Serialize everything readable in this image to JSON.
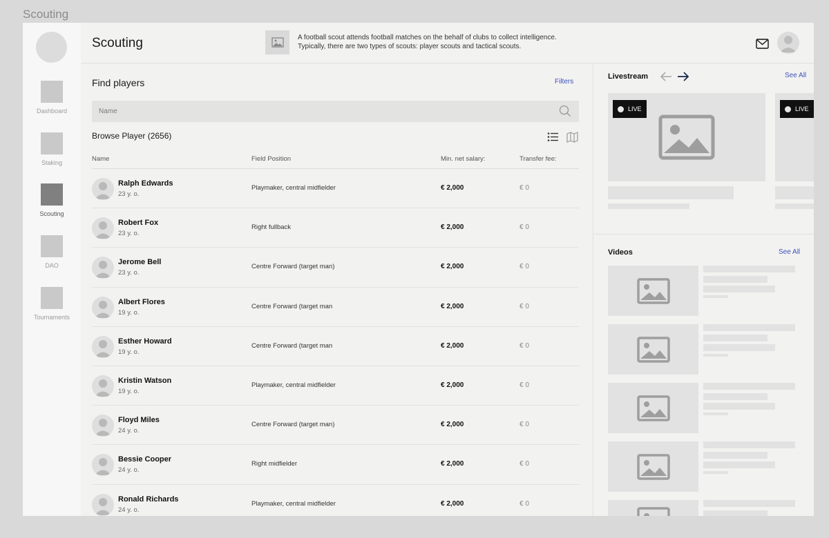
{
  "frame_label": "Scouting",
  "sidebar": {
    "items": [
      {
        "label": "Dashboard",
        "active": false
      },
      {
        "label": "Staking",
        "active": false
      },
      {
        "label": "Scouting",
        "active": true
      },
      {
        "label": "DAO",
        "active": false
      },
      {
        "label": "Tournaments",
        "active": false
      }
    ]
  },
  "header": {
    "title": "Scouting",
    "info_line1": "A football scout attends football matches on the behalf of clubs to collect intelligence.",
    "info_line2": "Typically, there are two types of scouts: player scouts and tactical scouts.",
    "mail_icon": "mail-icon"
  },
  "main": {
    "find_title": "Find players",
    "filters_label": "Filters",
    "search_placeholder": "Name",
    "browse_title": "Browse Player (2656)",
    "columns": {
      "name": "Name",
      "position": "Field Position",
      "salary": "Min. net salary:",
      "fee": "Transfer fee:"
    },
    "players": [
      {
        "name": "Ralph Edwards",
        "age": "23 y. o.",
        "position": "Playmaker, central midfielder",
        "salary": "€ 2,000",
        "fee": "€ 0"
      },
      {
        "name": "Robert Fox",
        "age": "23 y. o.",
        "position": "Right fullback",
        "salary": "€ 2,000",
        "fee": "€ 0"
      },
      {
        "name": "Jerome Bell",
        "age": "23 y. o.",
        "position": "Centre Forward (target man)",
        "salary": "€ 2,000",
        "fee": "€ 0"
      },
      {
        "name": "Albert Flores",
        "age": "19 y. o.",
        "position": "Centre Forward (target man",
        "salary": "€ 2,000",
        "fee": "€ 0"
      },
      {
        "name": "Esther Howard",
        "age": "19 y. o.",
        "position": "Centre Forward (target man",
        "salary": "€ 2,000",
        "fee": "€ 0"
      },
      {
        "name": "Kristin Watson",
        "age": "19 y. o.",
        "position": "Playmaker, central midfielder",
        "salary": "€ 2,000",
        "fee": "€ 0"
      },
      {
        "name": "Floyd Miles",
        "age": "24 y. o.",
        "position": "Centre Forward (target man)",
        "salary": "€ 2,000",
        "fee": "€ 0"
      },
      {
        "name": "Bessie Cooper",
        "age": "24 y. o.",
        "position": "Right midfielder",
        "salary": "€ 2,000",
        "fee": "€ 0"
      },
      {
        "name": "Ronald Richards",
        "age": "24 y. o.",
        "position": "Playmaker, central midfielder",
        "salary": "€ 2,000",
        "fee": "€ 0"
      }
    ]
  },
  "livestream": {
    "title": "Livestream",
    "see_all": "See All",
    "badge": "LIVE"
  },
  "videos": {
    "title": "Videos",
    "see_all": "See All"
  },
  "colors": {
    "accent": "#3d52b8",
    "live_badge": "#111111"
  }
}
